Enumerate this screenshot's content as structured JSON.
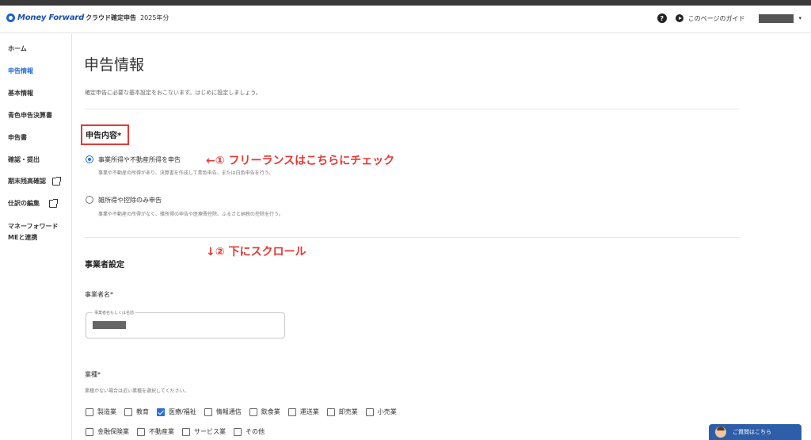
{
  "header": {
    "brand_name": "Money Forward",
    "product": "クラウド確定申告",
    "year": "2025年分",
    "help_icon": "?",
    "guide_link": "このページのガイド",
    "caret": "▾"
  },
  "sidebar": {
    "items": [
      {
        "label": "ホーム",
        "active": false
      },
      {
        "label": "申告情報",
        "active": true
      },
      {
        "label": "基本情報",
        "active": false
      },
      {
        "label": "青色申告決算書",
        "active": false
      },
      {
        "label": "申告書",
        "active": false
      },
      {
        "label": "確認・提出",
        "active": false
      },
      {
        "label": "期末残高確認",
        "active": false
      },
      {
        "label": "仕訳の編集",
        "active": false
      },
      {
        "label": "マネーフォワード",
        "active": false
      },
      {
        "label": "MEと連携",
        "active": false
      }
    ]
  },
  "main": {
    "title": "申告情報",
    "description": "確定申告に必要な基本設定をおこないます。はじめに設定しましょう。",
    "filing_section": {
      "heading": "申告内容*",
      "options": [
        {
          "label": "事業所得や不動産所得を申告",
          "description": "事業や不動産の所得があり、決算書を作成して青色申告、または白色申告を行う。",
          "checked": true
        },
        {
          "label": "雑所得や控除のみ申告",
          "description": "事業や不動産の所得がなく、雑所得の申告や医療費控除、ふるさと納税の控除を行う。",
          "checked": false
        }
      ]
    },
    "annotations": {
      "step1": "←① フリーランスはこちらにチェック",
      "step2": "↓② 下にスクロール"
    },
    "business_section": {
      "heading": "事業者設定",
      "name_label": "事業者名*",
      "name_placeholder": "事業者名もしくは名前",
      "industry_label": "業種*",
      "industry_help": "業種がない場合は近い業種を選択してください。",
      "industries_row1": [
        {
          "label": "製造業",
          "checked": false
        },
        {
          "label": "教育",
          "checked": false
        },
        {
          "label": "医療/福祉",
          "checked": true
        },
        {
          "label": "情報通信",
          "checked": false
        },
        {
          "label": "飲食業",
          "checked": false
        },
        {
          "label": "運送業",
          "checked": false
        },
        {
          "label": "卸売業",
          "checked": false
        },
        {
          "label": "小売業",
          "checked": false
        }
      ],
      "industries_row2": [
        {
          "label": "金融保険業",
          "checked": false
        },
        {
          "label": "不動産業",
          "checked": false
        },
        {
          "label": "サービス業",
          "checked": false
        },
        {
          "label": "その他",
          "checked": false
        }
      ]
    }
  },
  "question_button": "ご質問はこちら",
  "colors": {
    "accent": "#2a6fd6",
    "annotation": "#e53935",
    "brand": "#1a4fb0"
  }
}
